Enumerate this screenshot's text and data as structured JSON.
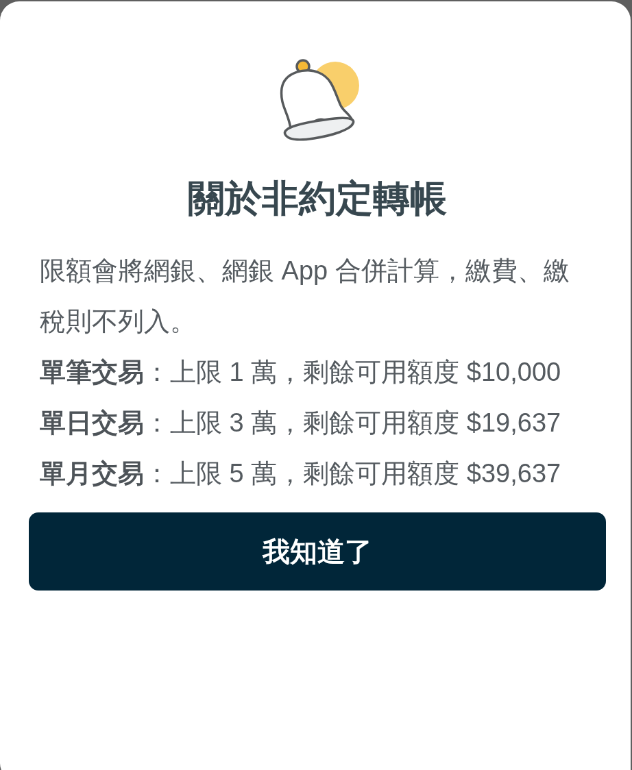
{
  "dialog": {
    "title": "關於非約定轉帳",
    "intro": "限額會將網銀、網銀 App 合併計算，繳費、繳稅則不列入。",
    "limits": [
      {
        "text": "**單筆交易**：上限 1 萬，剩餘可用額度 $10,000"
      },
      {
        "text": "**單日交易**：上限 3 萬，剩餘可用額度 $19,637"
      },
      {
        "text": "**單月交易**：上限 5 萬，剩餘可用額度 $39,637"
      }
    ],
    "button": "我知道了"
  }
}
